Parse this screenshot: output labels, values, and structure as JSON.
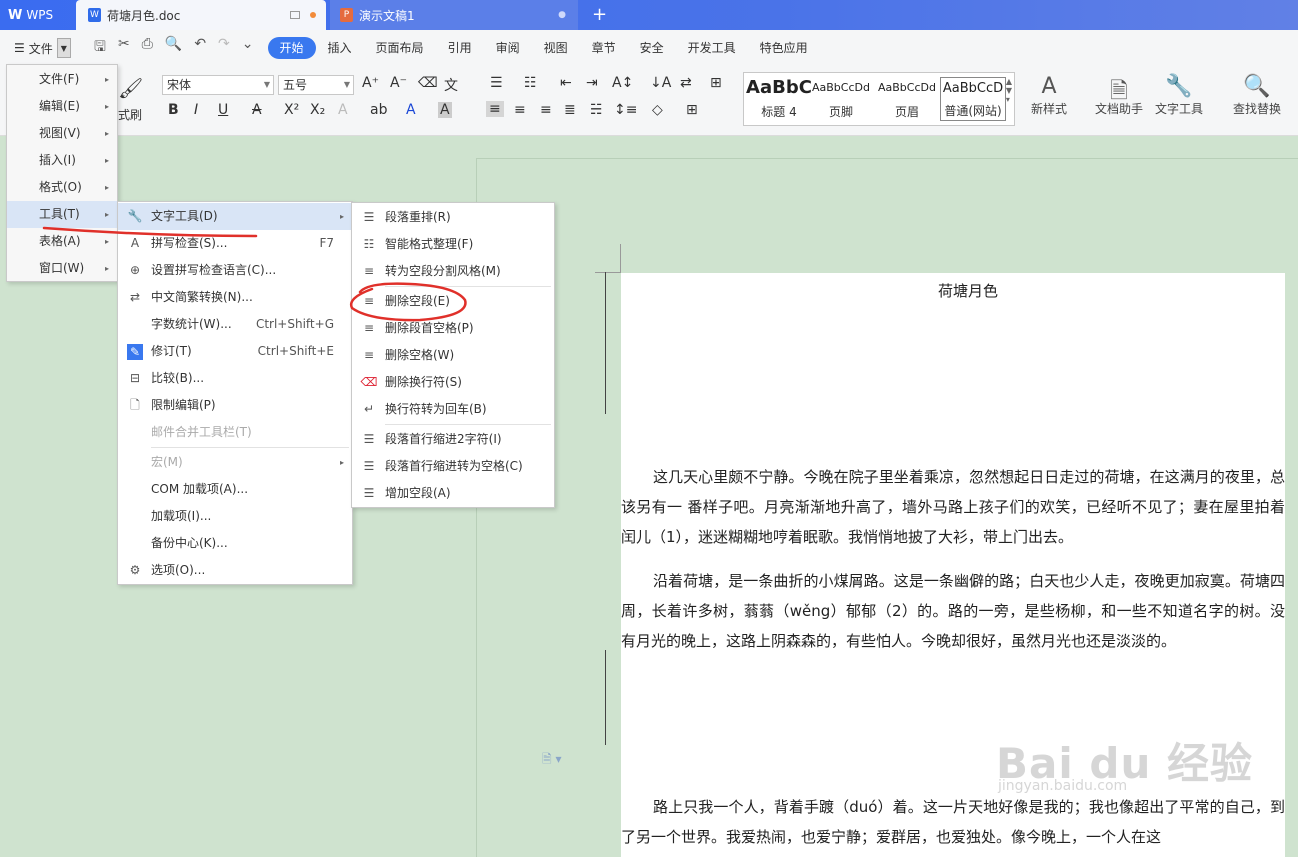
{
  "titlebar": {
    "app_label": "WPS",
    "doc_tab": "荷塘月色.doc",
    "ppt_tab": "演示文稿1",
    "new_tab": "+"
  },
  "menubar": {
    "file_label": "文件",
    "tabs": [
      "开始",
      "插入",
      "页面布局",
      "引用",
      "审阅",
      "视图",
      "章节",
      "安全",
      "开发工具",
      "特色应用"
    ]
  },
  "ribbon": {
    "font_name": "宋体",
    "font_size": "五号",
    "format_painter": "式刷",
    "styles": [
      {
        "sample": "AaBbC",
        "name": "标题 4"
      },
      {
        "sample": "AaBbCcDd",
        "name": "页脚"
      },
      {
        "sample": "AaBbCcDd",
        "name": "页眉"
      },
      {
        "sample": "AaBbCcD",
        "name": "普通(网站)"
      }
    ],
    "new_style": "新样式",
    "doc_assistant": "文档助手",
    "text_tools": "文字工具",
    "find_replace": "查找替换"
  },
  "menu_main": {
    "items": [
      "文件(F)",
      "编辑(E)",
      "视图(V)",
      "插入(I)",
      "格式(O)",
      "工具(T)",
      "表格(A)",
      "窗口(W)"
    ]
  },
  "menu_tools": {
    "items": [
      {
        "label": "文字工具(D)",
        "key": "",
        "icon": "wrench-icon"
      },
      {
        "label": "拼写检查(S)...",
        "key": "F7",
        "icon": "spellcheck-icon"
      },
      {
        "label": "设置拼写检查语言(C)...",
        "key": "",
        "icon": "globe-icon"
      },
      {
        "label": "中文简繁转换(N)...",
        "key": "",
        "icon": "convert-icon"
      },
      {
        "label": "字数统计(W)...",
        "key": "Ctrl+Shift+G",
        "icon": ""
      },
      {
        "label": "修订(T)",
        "key": "Ctrl+Shift+E",
        "icon": "track-changes-icon"
      },
      {
        "label": "比较(B)...",
        "key": "",
        "icon": "compare-icon"
      },
      {
        "label": "限制编辑(P)",
        "key": "",
        "icon": "restrict-edit-icon"
      },
      {
        "label": "邮件合并工具栏(T)",
        "key": "",
        "icon": ""
      },
      {
        "label": "宏(M)",
        "key": "",
        "icon": ""
      },
      {
        "label": "COM 加载项(A)...",
        "key": "",
        "icon": ""
      },
      {
        "label": "加载项(I)...",
        "key": "",
        "icon": ""
      },
      {
        "label": "备份中心(K)...",
        "key": "",
        "icon": ""
      },
      {
        "label": "选项(O)...",
        "key": "",
        "icon": "gear-icon"
      }
    ]
  },
  "menu_text_tools": {
    "items": [
      "段落重排(R)",
      "智能格式整理(F)",
      "转为空段分割风格(M)",
      "删除空段(E)",
      "删除段首空格(P)",
      "删除空格(W)",
      "删除换行符(S)",
      "换行符转为回车(B)",
      "段落首行缩进2字符(I)",
      "段落首行缩进转为空格(C)",
      "增加空段(A)"
    ]
  },
  "document": {
    "title": "荷塘月色",
    "paragraphs": [
      "这几天心里颇不宁静。今晚在院子里坐着乘凉，忽然想起日日走过的荷塘，在这满月的夜里，总该另有一 番样子吧。月亮渐渐地升高了，墙外马路上孩子们的欢笑，已经听不见了；妻在屋里拍着闰儿（1），迷迷糊糊地哼着眠歌。我悄悄地披了大衫，带上门出去。",
      "沿着荷塘，是一条曲折的小煤屑路。这是一条幽僻的路；白天也少人走，夜晚更加寂寞。荷塘四周，长着许多树，蓊蓊（wěng）郁郁（2）的。路的一旁，是些杨柳，和一些不知道名字的树。没有月光的晚上，这路上阴森森的，有些怕人。今晚却很好，虽然月光也还是淡淡的。",
      "路上只我一个人，背着手踱（duó）着。这一片天地好像是我的；我也像超出了平常的自己，到了另一个世界。我爱热闹，也爱宁静；爱群居，也爱独处。像今晚上，一个人在这"
    ]
  },
  "watermark": {
    "brand": "Bai du 经验",
    "url": "jingyan.baidu.com"
  },
  "colors": {
    "accent": "#3978ef",
    "titlebar": "#3a6cf0",
    "page_bg": "#cfe3cf",
    "menu_highlight": "#d9e5f6",
    "annotation_red": "#e0302a"
  }
}
